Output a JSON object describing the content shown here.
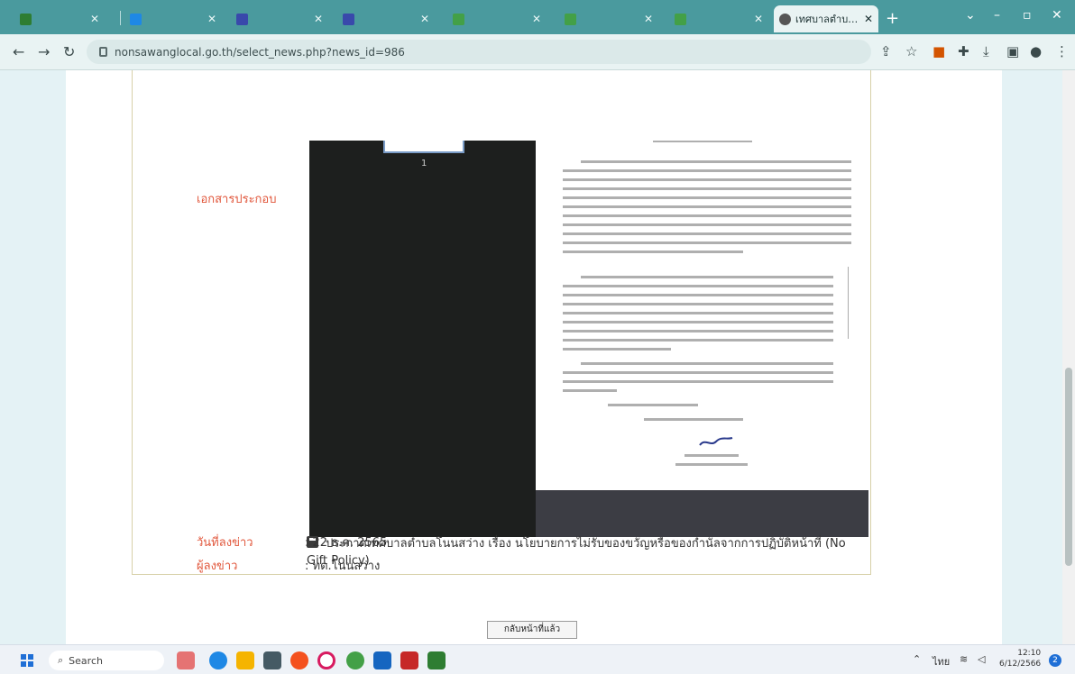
{
  "browser": {
    "tabs": [
      {
        "title": "",
        "favicon_color": "#2e7d32"
      },
      {
        "title": "",
        "favicon_color": "#1e88e5"
      },
      {
        "title": "",
        "favicon_color": "#3949ab"
      },
      {
        "title": "",
        "favicon_color": "#3949ab"
      },
      {
        "title": "",
        "favicon_color": "#43a047"
      },
      {
        "title": "",
        "favicon_color": "#43a047"
      },
      {
        "title": "",
        "favicon_color": "#43a047"
      },
      {
        "title": "เทศบาลตำบลโน",
        "favicon_color": "#555555",
        "active": true
      }
    ],
    "url": "nonsawanglocal.go.th/select_news.php?news_id=986"
  },
  "page": {
    "attachment_label": "เอกสารประกอบ",
    "document_page_number": "1",
    "document_caption": "ประกาศเทศบาลตำบลโนนสว่าง เรื่อง นโยบายการไม่รับของขวัญหรือของกำนัลจากการปฏิบัติหน้าที่ (No Gift Policy)",
    "date_label": "วันที่ลงข่าว",
    "date_value": ": 22 ธ.ค. 2565",
    "author_label": "ผู้ลงข่าว",
    "author_value": ": ทต.โนนสว่าง",
    "back_button": "กลับหน้าที่แล้ว"
  },
  "taskbar": {
    "search_placeholder": "Search",
    "language": "ไทย",
    "time": "12:10",
    "date": "6/12/2566",
    "notification_count": "2"
  },
  "colors": {
    "tab_strip": "#4a9a9e",
    "label_accent": "#e1573c"
  }
}
